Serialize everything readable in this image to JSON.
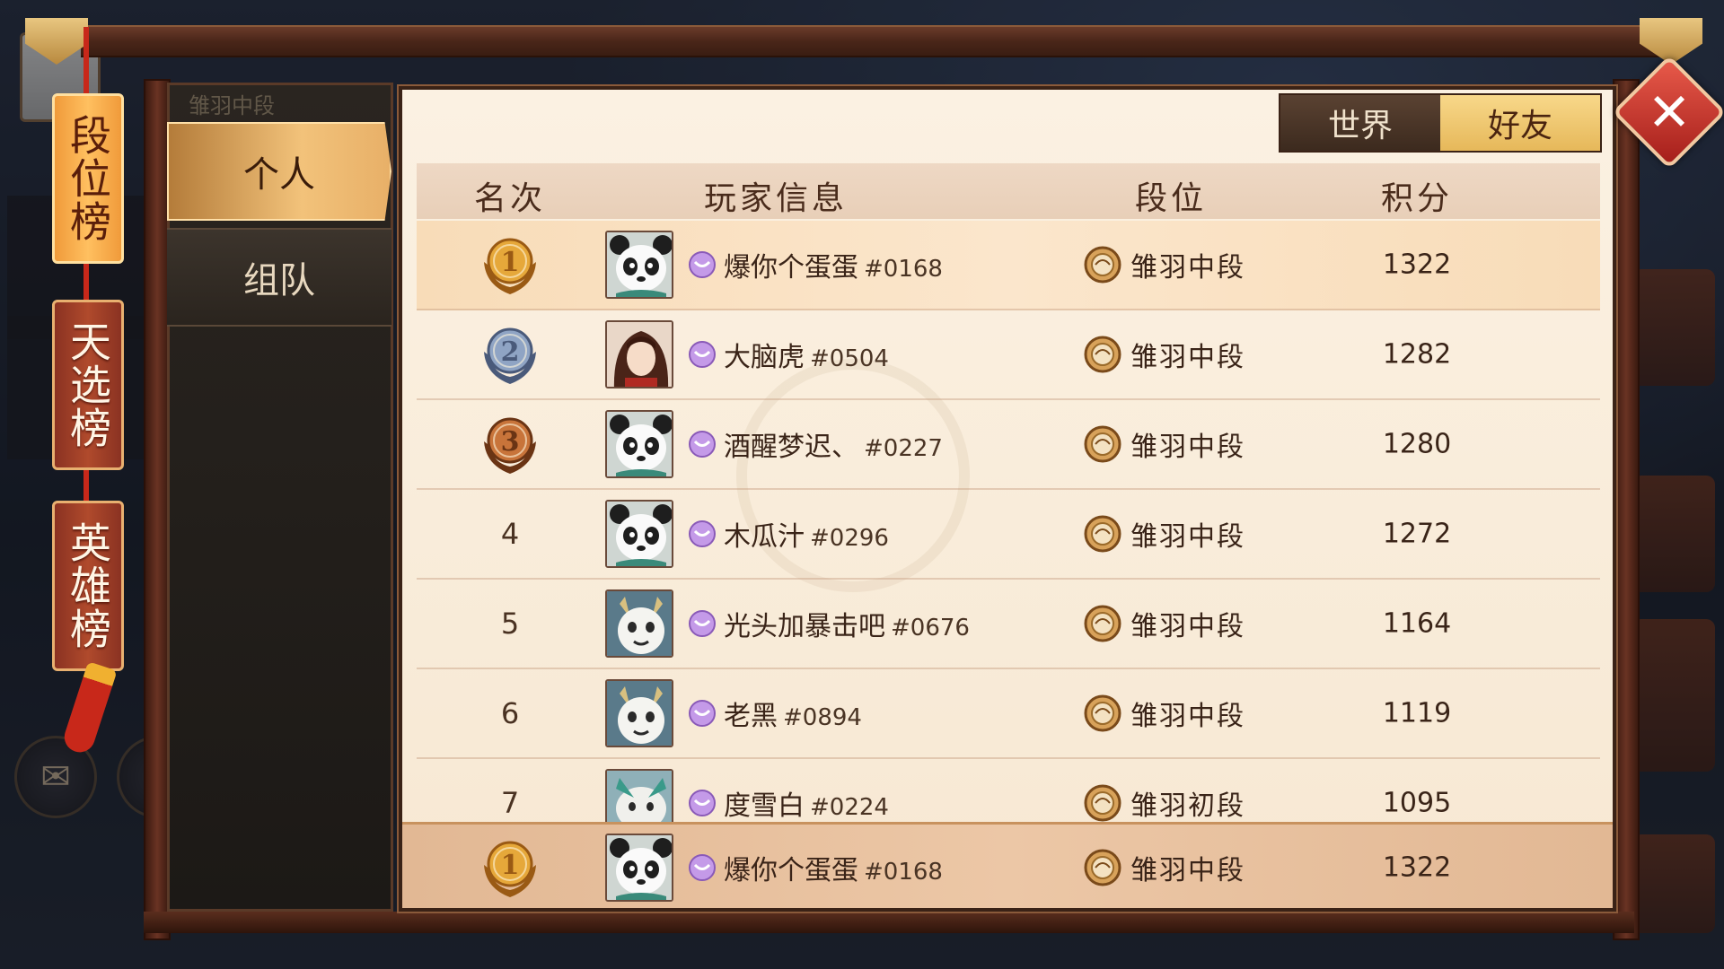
{
  "side_tabs": [
    {
      "label": "段位榜",
      "active": true
    },
    {
      "label": "天选榜",
      "active": false
    },
    {
      "label": "英雄榜",
      "active": false
    }
  ],
  "categories": [
    {
      "label": "个人",
      "active": true
    },
    {
      "label": "组队",
      "active": false
    }
  ],
  "category_header": "雏羽中段",
  "filters": [
    {
      "label": "世界",
      "active": false
    },
    {
      "label": "好友",
      "active": true
    }
  ],
  "columns": {
    "rank": "名次",
    "player": "玩家信息",
    "tier": "段位",
    "score": "积分"
  },
  "rows": [
    {
      "rank": "1",
      "name": "爆你个蛋蛋",
      "tag": "#0168",
      "tier": "雏羽中段",
      "score": "1322",
      "avatar": "panda"
    },
    {
      "rank": "2",
      "name": "大脑虎",
      "tag": "#0504",
      "tier": "雏羽中段",
      "score": "1282",
      "avatar": "girl"
    },
    {
      "rank": "3",
      "name": "酒醒梦迟、",
      "tag": "#0227",
      "tier": "雏羽中段",
      "score": "1280",
      "avatar": "panda"
    },
    {
      "rank": "4",
      "name": "木瓜汁",
      "tag": "#0296",
      "tier": "雏羽中段",
      "score": "1272",
      "avatar": "panda"
    },
    {
      "rank": "5",
      "name": "光头加暴击吧",
      "tag": "#0676",
      "tier": "雏羽中段",
      "score": "1164",
      "avatar": "beast"
    },
    {
      "rank": "6",
      "name": "老黑",
      "tag": "#0894",
      "tier": "雏羽中段",
      "score": "1119",
      "avatar": "beast"
    },
    {
      "rank": "7",
      "name": "度雪白",
      "tag": "#0224",
      "tier": "雏羽初段",
      "score": "1095",
      "avatar": "dragon"
    }
  ],
  "self": {
    "rank": "1",
    "name": "爆你个蛋蛋",
    "tag": "#0168",
    "tier": "雏羽中段",
    "score": "1322",
    "avatar": "panda"
  },
  "colors": {
    "gold": "#f2c27a",
    "medal_gold": "#e6a83a",
    "medal_silver": "#8fa4c4",
    "medal_bronze": "#c8743a",
    "close": "#c8281a"
  },
  "icons": [
    "close-icon",
    "vip-badge-icon",
    "tier-badge-icon",
    "rank-medal-icon",
    "mail-icon"
  ]
}
